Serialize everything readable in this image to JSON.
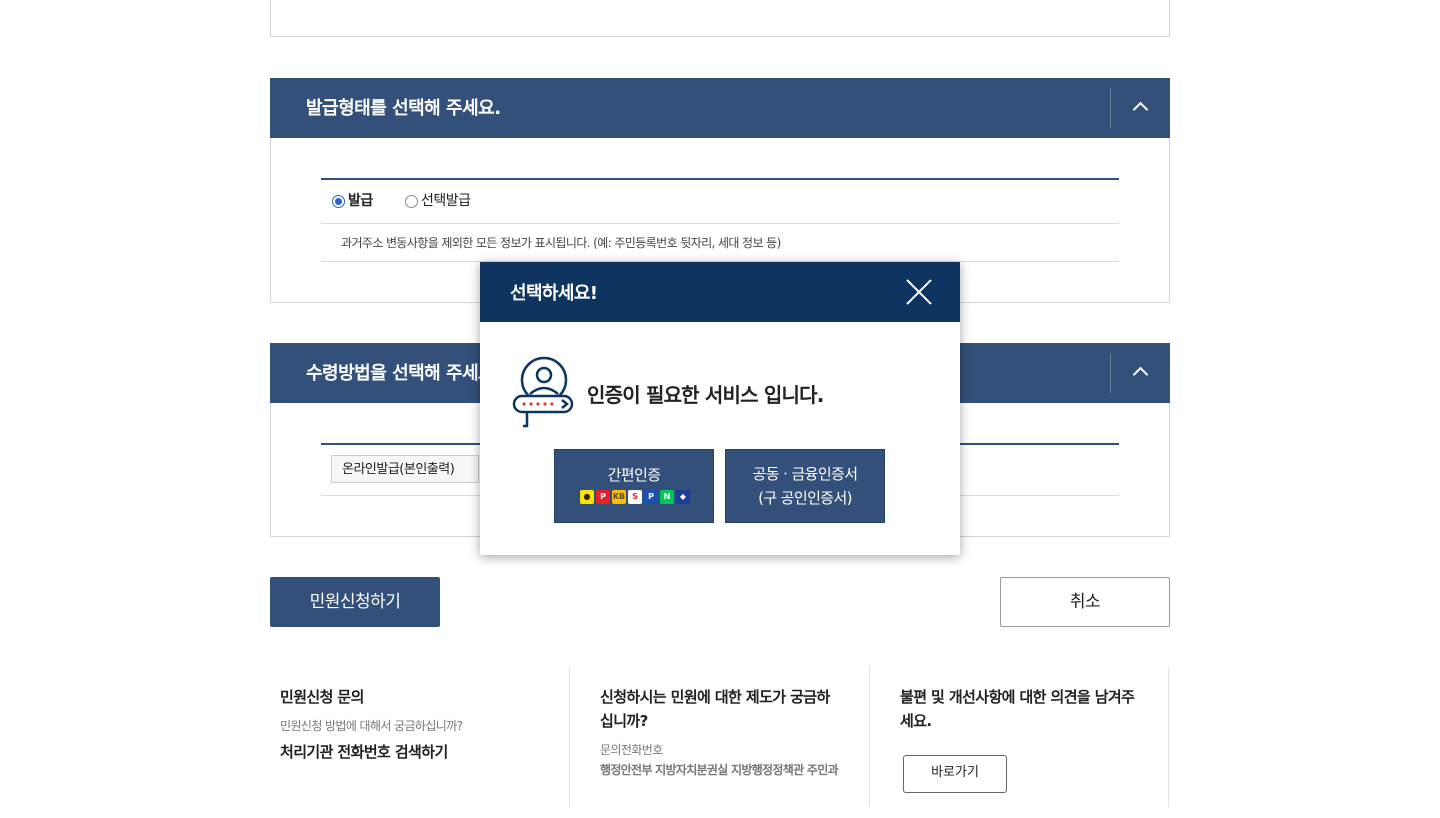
{
  "issue_type_section": {
    "title": "발급형태를 선택해 주세요.",
    "options": [
      {
        "label": "발급",
        "selected": true
      },
      {
        "label": "선택발급",
        "selected": false
      }
    ],
    "notice": "과거주소 변동사항을 제외한 모든 정보가 표시됩니다. (예: 주민등록번호 뒷자리, 세대 정보 등)"
  },
  "receive_section": {
    "title": "수령방법을 선택해 주세요.",
    "method": "온라인발급(본인출력)"
  },
  "actions": {
    "apply_label": "민원신청하기",
    "cancel_label": "취소"
  },
  "info": [
    {
      "title": "민원신청 문의",
      "sub": "민원신청 방법에 대해서 궁금하십니까?",
      "link": "처리기관 전화번호 검색하기"
    },
    {
      "title": "신청하시는 민원에 대한 제도가 궁금하십니까?",
      "sub": "문의전화번호",
      "detail": "행정안전부 지방자치분권실 지방행정정책관 주민과"
    },
    {
      "title": "불편 및 개선사항에 대한 의견을 남겨주세요.",
      "button_label": "바로가기"
    }
  ],
  "modal": {
    "title": "선택하세요!",
    "message": "인증이 필요한 서비스 입니다.",
    "simple_auth_label": "간편인증",
    "cert_label_line1": "공동 · 금융인증서",
    "cert_label_line2": "(구 공인인증서)",
    "provider_logos": [
      {
        "name": "kakao",
        "text": "●",
        "bg": "#f7e600",
        "fg": "#3a1d1d"
      },
      {
        "name": "payco",
        "text": "P",
        "bg": "#e4202a",
        "fg": "#ffffff"
      },
      {
        "name": "kb",
        "text": "KB",
        "bg": "#ffbc00",
        "fg": "#5a4a2a"
      },
      {
        "name": "samsung-pass",
        "text": "S",
        "bg": "#ffffff",
        "fg": "#e0242a"
      },
      {
        "name": "pass",
        "text": "P",
        "bg": "#1a4fb5",
        "fg": "#ffffff"
      },
      {
        "name": "naver",
        "text": "N",
        "bg": "#03c75a",
        "fg": "#ffffff"
      },
      {
        "name": "shinhan",
        "text": "◆",
        "bg": "#1a3f9a",
        "fg": "#ffffff"
      }
    ]
  },
  "colors": {
    "header_bg": "#33507a",
    "modal_header_bg": "#0e355f",
    "radio_accent": "#2b63c4"
  }
}
